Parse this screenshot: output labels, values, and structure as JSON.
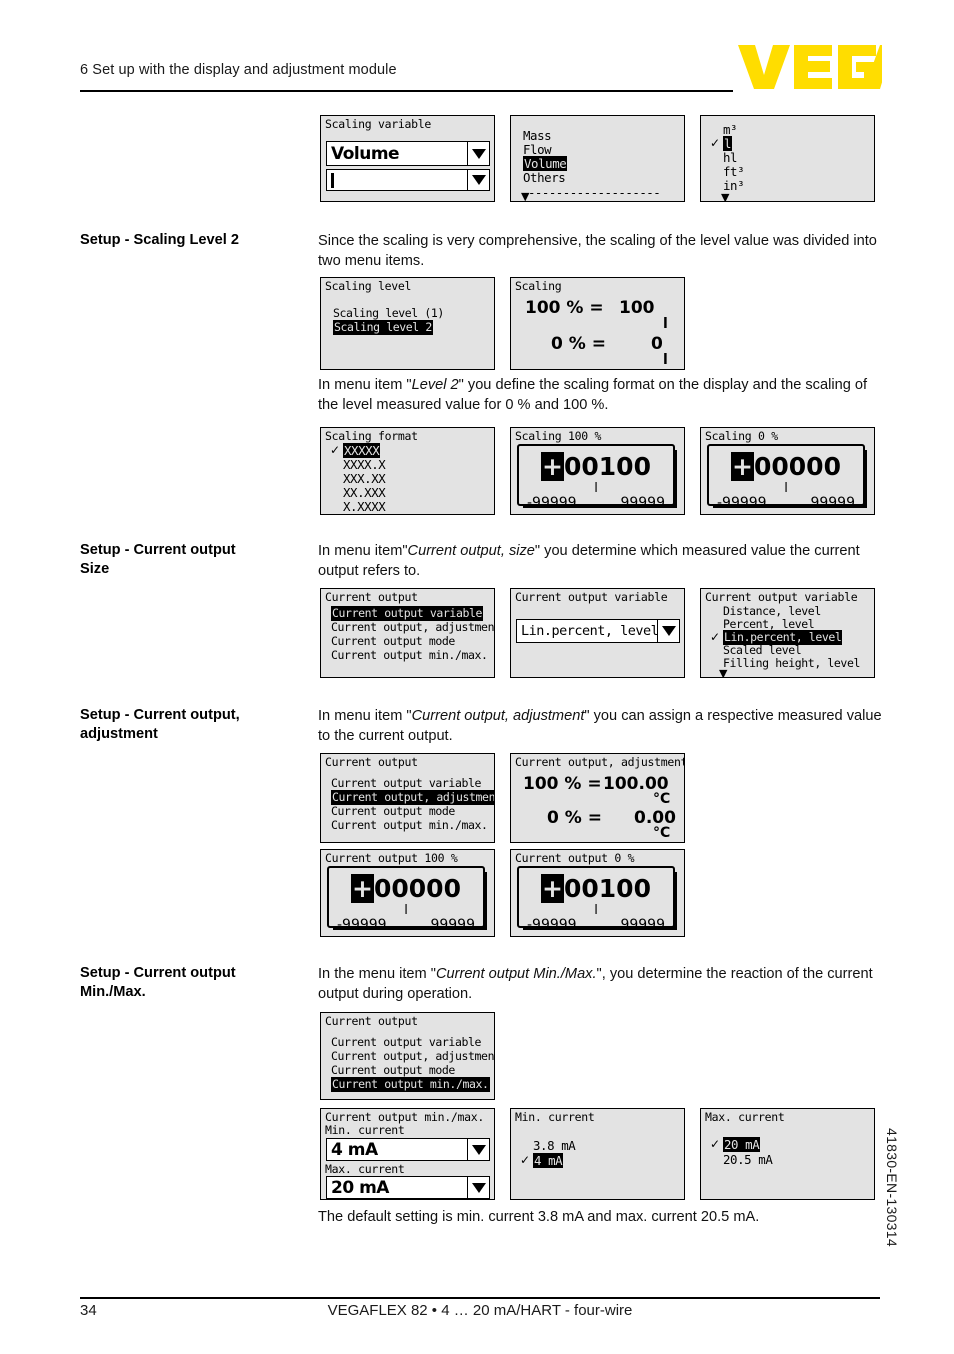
{
  "header": {
    "chapter_title": "6 Set up with the display and adjustment module",
    "logo_text": "VEGA"
  },
  "side_code": "41830-EN-130314",
  "footer": {
    "page_number": "34",
    "product": "VEGAFLEX 82 • 4 … 20 mA/HART - four-wire"
  },
  "sections": [
    {
      "title": "Setup - Scaling Level 2",
      "body": "Since the scaling is very comprehensive, the scaling of the level value was divided into two menu items."
    },
    {
      "body_pre": "In menu item \"",
      "body_em": "Level 2",
      "body_post": "\" you define the scaling format on the display and the scaling of the level measured value for 0 % and 100 %."
    },
    {
      "title_line1": "Setup - Current output",
      "title_line2": "Size",
      "body_pre": "In menu item\"",
      "body_em": "Current output, size",
      "body_post": "\" you determine which measured value the current output refers to."
    },
    {
      "title_line1": "Setup - Current output,",
      "title_line2": "adjustment",
      "body_pre": "In menu item \"",
      "body_em": "Current output, adjustment",
      "body_post": "\" you can assign a respective measured value to the current output."
    },
    {
      "title_line1": "Setup - Current output",
      "title_line2": "Min./Max.",
      "body_pre": "In the menu item \"",
      "body_em": "Current output Min./Max.",
      "body_post": "\", you determine the reaction of the current output during operation."
    }
  ],
  "closing_note": "The default setting is min. current 3.8 mA and max. current 20.5 mA.",
  "screens": {
    "scaling_variable_combo": {
      "title": "Scaling variable",
      "value1": "Volume",
      "value2": ""
    },
    "scaling_variable_list": {
      "items": [
        "Mass",
        "Flow",
        "Volume",
        "Others"
      ],
      "selected": "Volume",
      "divider": "--------------------",
      "more_arrow": "▼"
    },
    "scaling_unit_list": {
      "items": [
        "m³",
        "l",
        "hl",
        "ft³",
        "in³"
      ],
      "selected": "l",
      "checked": "l",
      "more_arrow": "▼"
    },
    "scaling_level_menu": {
      "title": "Scaling level",
      "items": [
        "Scaling level (1)",
        "Scaling level 2"
      ],
      "selected": "Scaling level 2"
    },
    "scaling_eq": {
      "title": "Scaling",
      "rows": [
        {
          "percent": "100 % =",
          "value": "100",
          "unit": "l"
        },
        {
          "percent": "0 % =",
          "value": "0",
          "unit": "l"
        }
      ]
    },
    "scaling_format": {
      "title": "Scaling format",
      "items": [
        "XXXXX",
        "XXXX.X",
        "XXX.XX",
        "XX.XXX",
        "X.XXXX"
      ],
      "selected": "XXXXX",
      "checked": "XXXXX"
    },
    "scaling_100": {
      "title": "Scaling 100 %",
      "sign": "+",
      "digits": "00100",
      "unit": "l",
      "min": "-99999",
      "max": "99999"
    },
    "scaling_0": {
      "title": "Scaling 0 %",
      "sign": "+",
      "digits": "00000",
      "unit": "l",
      "min": "-99999",
      "max": "99999"
    },
    "current_output_menu_variable": {
      "title": "Current output",
      "items": [
        "Current output variable",
        "Current output, adjustment",
        "Current output mode",
        "Current output min./max."
      ],
      "selected": "Current output variable"
    },
    "current_output_variable_combo": {
      "title": "Current output variable",
      "value": "Lin.percent, level"
    },
    "current_output_variable_list": {
      "title": "Current output variable",
      "items": [
        "Distance, level",
        "Percent, level",
        "Lin.percent, level",
        "Scaled level",
        "Filling height, level"
      ],
      "selected": "Lin.percent, level",
      "checked": "Lin.percent, level",
      "more_arrow": "▼"
    },
    "current_output_menu_adjustment": {
      "title": "Current output",
      "items": [
        "Current output variable",
        "Current output, adjustment",
        "Current output mode",
        "Current output min./max."
      ],
      "selected": "Current output, adjustment"
    },
    "current_output_adjustment_eq": {
      "title": "Current output, adjustment",
      "rows": [
        {
          "percent": "100 % =",
          "value": "100.00",
          "unit": "°C"
        },
        {
          "percent": "0 % =",
          "value": "0.00",
          "unit": "°C"
        }
      ]
    },
    "current_output_100": {
      "title": "Current output 100 %",
      "sign": "+",
      "digits": "00000",
      "unit": "l",
      "min": "-99999",
      "max": "99999"
    },
    "current_output_0": {
      "title": "Current output 0 %",
      "sign": "+",
      "digits": "00100",
      "unit": "l",
      "min": "-99999",
      "max": "99999"
    },
    "current_output_menu_minmax": {
      "title": "Current output",
      "items": [
        "Current output variable",
        "Current output, adjustment",
        "Current output mode",
        "Current output min./max."
      ],
      "selected": "Current output min./max."
    },
    "current_output_minmax_combo": {
      "title": "Current output min./max.",
      "min_label": "Min. current",
      "min_value": "4 mA",
      "max_label": "Max. current",
      "max_value": "20 mA"
    },
    "min_current_list": {
      "title": "Min. current",
      "items": [
        "3.8 mA",
        "4 mA"
      ],
      "selected": "4 mA",
      "checked": "4 mA"
    },
    "max_current_list": {
      "title": "Max. current",
      "items": [
        "20 mA",
        "20.5 mA"
      ],
      "selected": "20 mA",
      "checked": "20 mA"
    }
  },
  "colors": {
    "brand_yellow": "#FFDD00",
    "lcd_background": "#E3E3E3",
    "text": "#000000"
  }
}
